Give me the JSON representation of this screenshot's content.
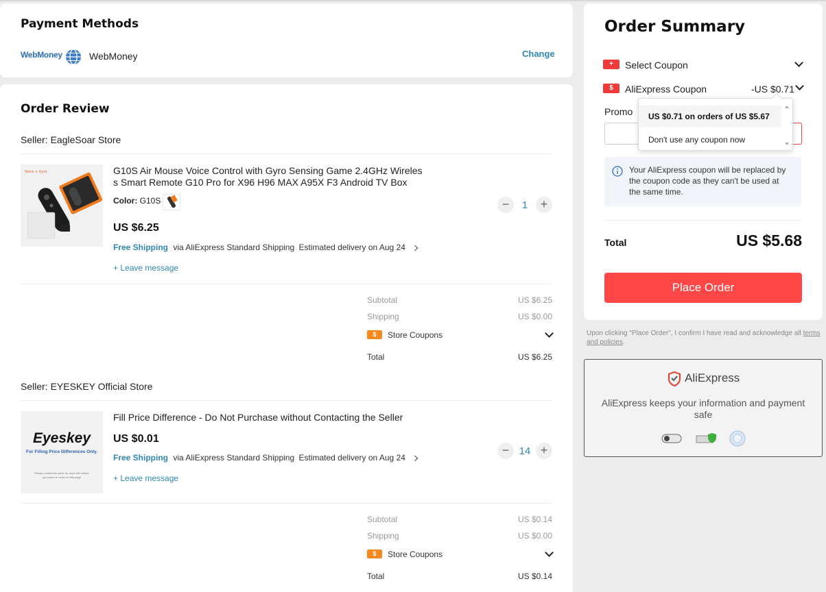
{
  "payment": {
    "title": "Payment Methods",
    "method_logo_text": "WebMoney",
    "method_name": "WebMoney",
    "change_label": "Change"
  },
  "review": {
    "title": "Order Review",
    "leave_message": "+ Leave message",
    "free_shipping": "Free Shipping",
    "sellers": [
      {
        "seller": "Seller: EagleSoar Store",
        "item_title_1": "G10S Air Mouse Voice Control with Gyro Sensing Game 2.4GHz Wireles",
        "item_title_2": "s Smart Remote G10 Pro for X96 H96 MAX A95X F3 Android TV Box",
        "color_label": "Color:",
        "color_value": "G10S",
        "price": "US $6.25",
        "shipping_via": "via AliExpress Standard Shipping",
        "delivery": "Estimated delivery on Aug 24",
        "qty": "1",
        "subtotal_label": "Subtotal",
        "subtotal_value": "US $6.25",
        "shipping_label": "Shipping",
        "shipping_value": "US $0.00",
        "store_coupons": "Store Coupons",
        "total_label": "Total",
        "total_value": "US $6.25"
      },
      {
        "seller": "Seller: EYESKEY Official Store",
        "item_title": "Fill Price Difference - Do Not Purchase without Contacting the Seller",
        "thumb_brand": "Eyeskey",
        "thumb_tagline": "For Filling Price Differences Only.",
        "thumb_note_1": "Please contact the seller for more info before",
        "thumb_note_2": "you place an order on this page",
        "price": "US $0.01",
        "shipping_via": "via AliExpress Standard Shipping",
        "delivery": "Estimated delivery on Aug 24",
        "qty": "14",
        "subtotal_label": "Subtotal",
        "subtotal_value": "US $0.14",
        "shipping_label": "Shipping",
        "shipping_value": "US $0.00",
        "store_coupons": "Store Coupons",
        "total_label": "Total",
        "total_value": "US $0.14"
      }
    ]
  },
  "summary": {
    "title": "Order Summary",
    "select_coupon": "Select Coupon",
    "ae_coupon": "AliExpress Coupon",
    "ae_coupon_value": "-US $0.71",
    "promo_label": "Promo",
    "dropdown_options": [
      "US $0.71 on orders of US $5.67",
      "Don't use any coupon now"
    ],
    "info_text_1": "Your AliExpress coupon will be replaced by",
    "info_text_2": "the coupon code as they can't be used at",
    "info_text_3": "the same time.",
    "total_label": "Total",
    "total_value": "US $5.68",
    "place_order": "Place Order",
    "terms_prefix": "Upon clicking \"Place Order\", I confirm I have read and acknowledge all",
    "terms_link": "terms and policies",
    "terms_suffix": "."
  },
  "trust": {
    "brand": "AliExpress",
    "text_1": "AliExpress keeps your information and payment",
    "text_2": "safe"
  },
  "colors": {
    "accent_red": "#ff4747",
    "link_blue": "#2f87b3",
    "coupon_orange": "#f7891e"
  }
}
